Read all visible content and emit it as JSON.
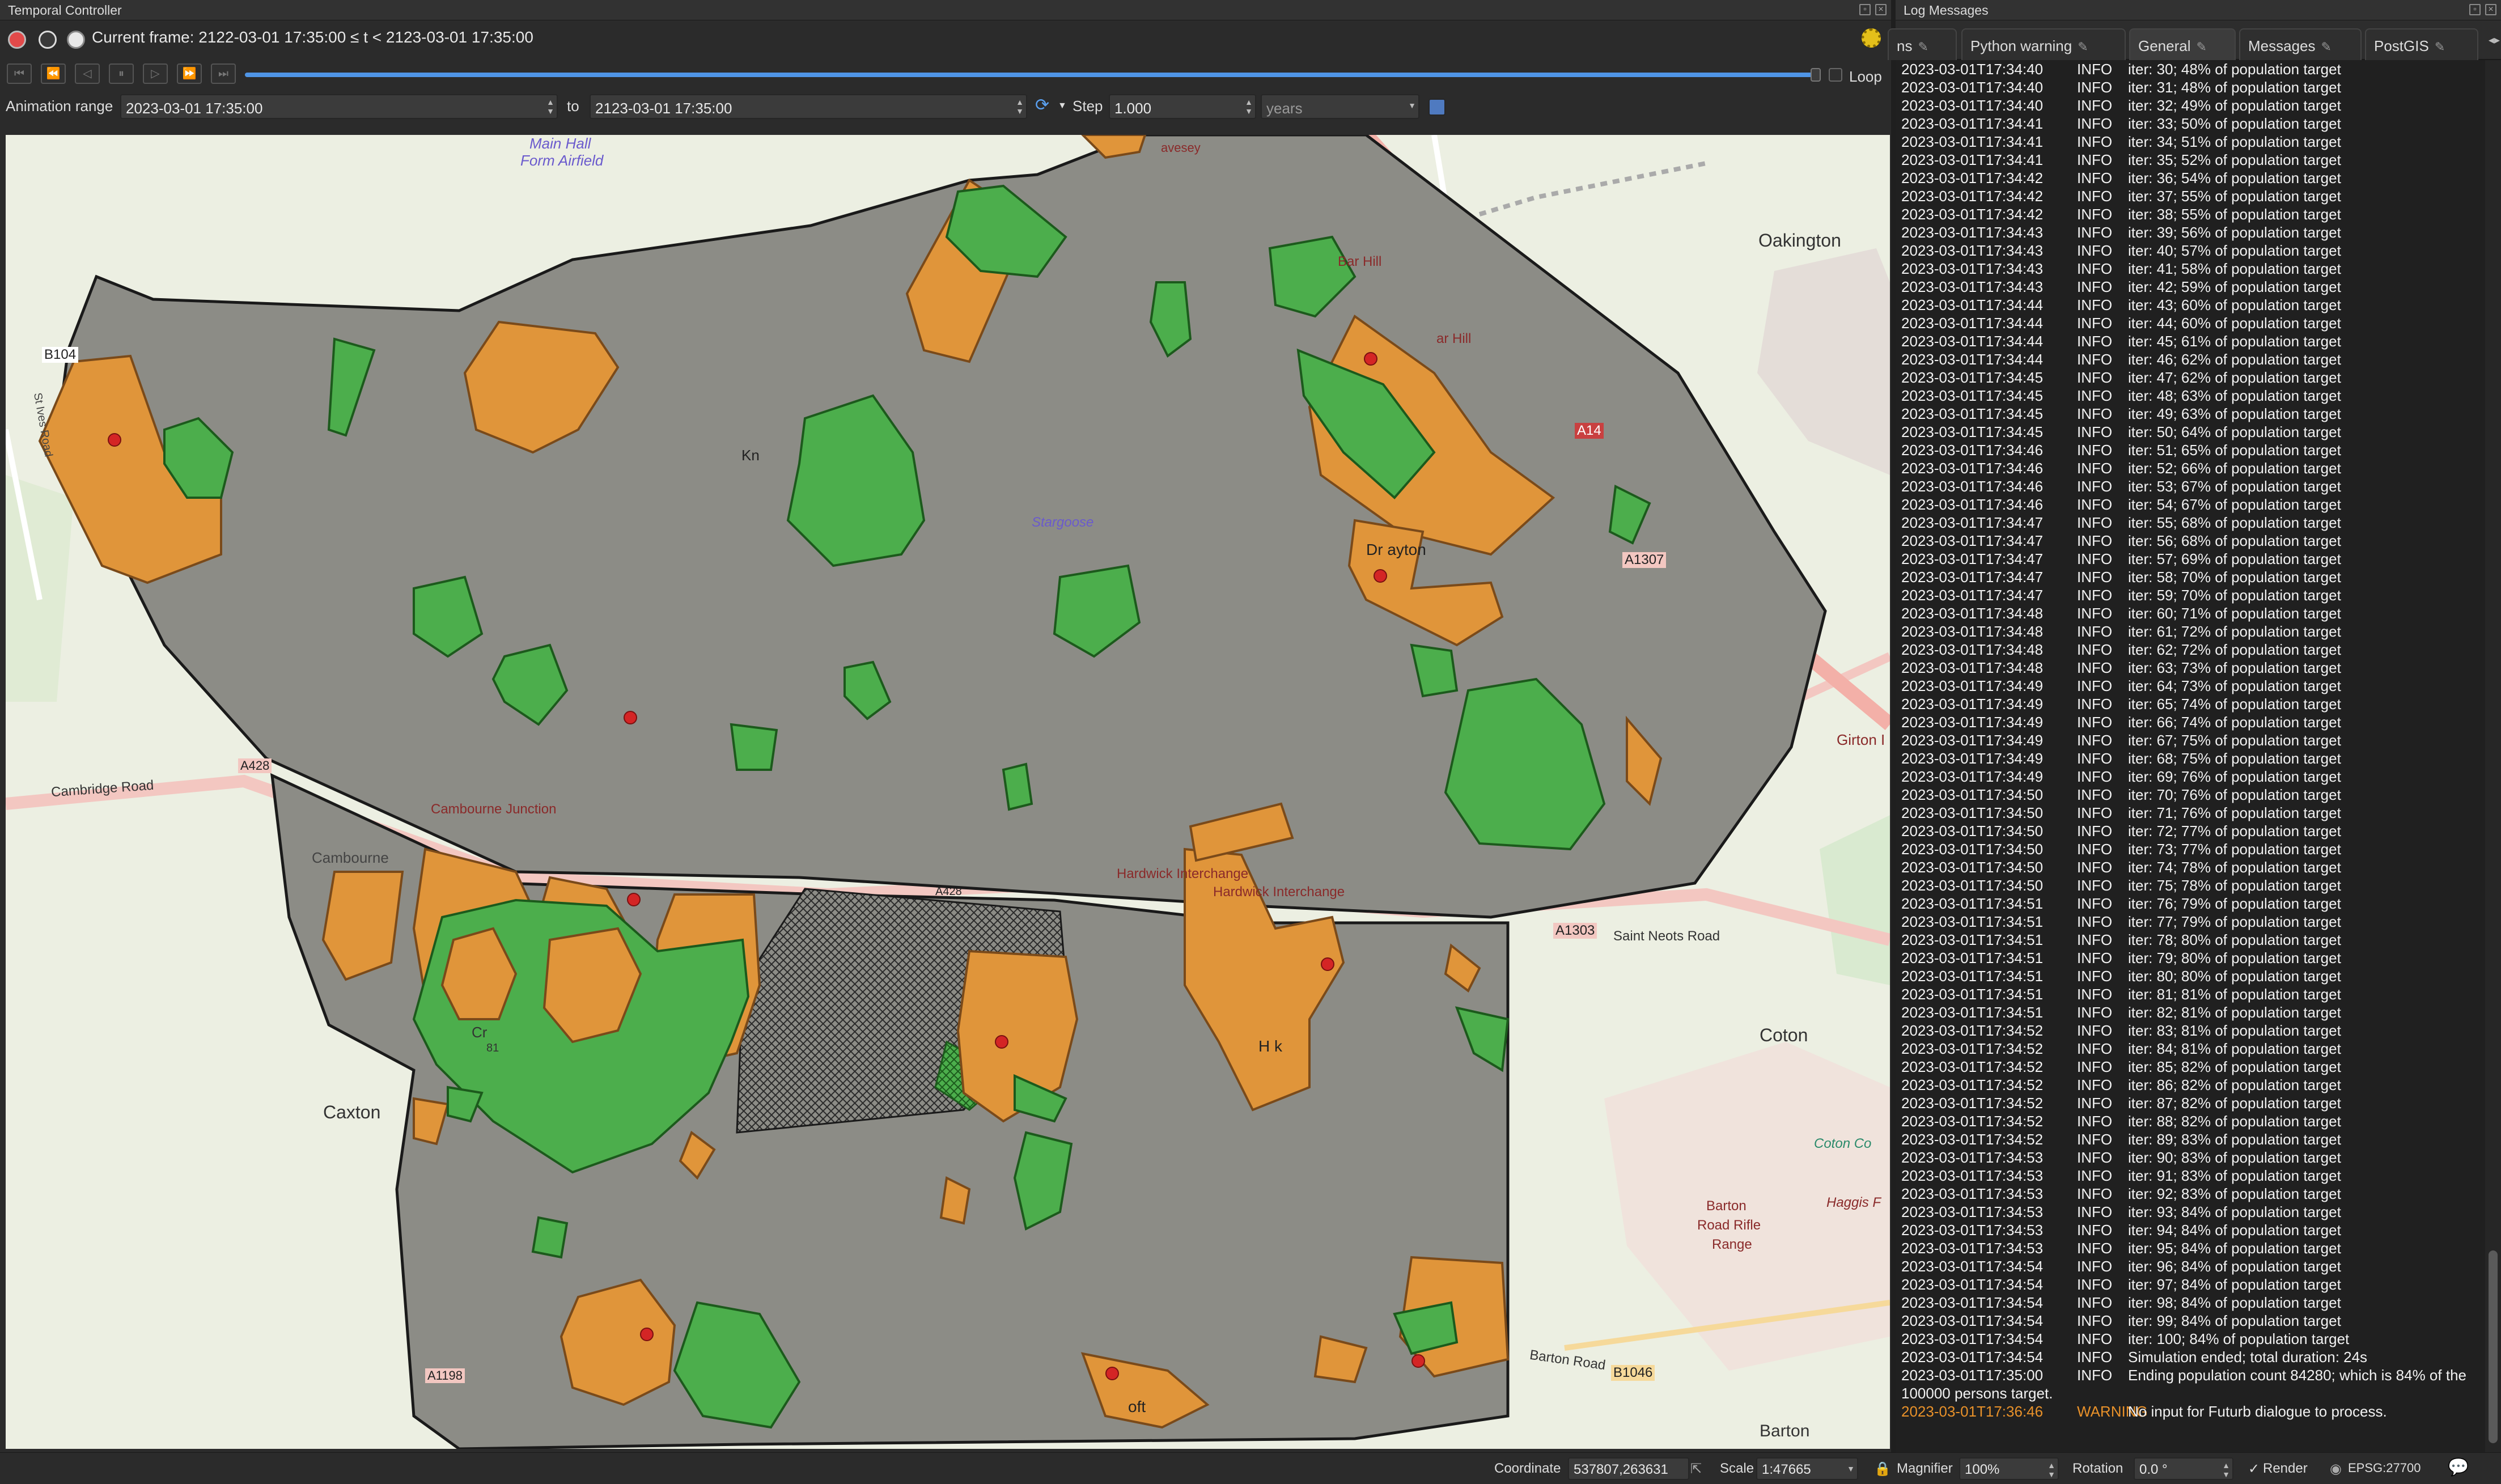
{
  "temporal_controller": {
    "title": "Temporal Controller",
    "current_frame": "Current frame: 2122-03-01 17:35:00 ≤ t < 2123-03-01 17:35:00",
    "loop_label": "Loop",
    "animation_range_label": "Animation range",
    "range_start": "2023-03-01 17:35:00",
    "to_label": "to",
    "range_end": "2123-03-01 17:35:00",
    "step_label": "Step",
    "step_value": "1.000",
    "step_unit": "years"
  },
  "map": {
    "labels": {
      "main_hall": "Main Hall",
      "form_airfield": "Form Airfield",
      "b1040": "B104",
      "st_ives_road": "St Ives Road",
      "oakington": "Oakington",
      "bar_hill_1": "Bar Hill",
      "bar_hill_2": "ar Hill",
      "a14": "A14",
      "knapwell": "Kn",
      "stargoose": "Stargoose",
      "dry_drayton": "Dr    ayton",
      "a1307": "A1307",
      "girton": "Girton I",
      "cambridge_road": "Cambridge Road",
      "a428_left": "A428",
      "cambourne_junction": "Cambourne Junction",
      "cambourne": "Cambourne",
      "hardwick_interchange_1": "Hardwick Interchange",
      "hardwick_interchange_2": "Hardwick Interchange",
      "a428_mid": "A428",
      "a1303": "A1303",
      "st_neots_road": "Saint Neots Road",
      "coton": "Coton",
      "caxton": "Caxton",
      "hardwick": "H     k",
      "coton_countryside": "Coton Co",
      "barton_rifle_1": "Barton",
      "barton_rifle_2": "Road Rifle",
      "barton_rifle_3": "Range",
      "haggis": "Haggis F",
      "barton_road": "Barton Road",
      "b1046": "B1046",
      "barton": "Barton",
      "a1198": "A1198",
      "toft": "oft",
      "eversden": "avesey",
      "cr": "Cr",
      "num81": "81"
    }
  },
  "status_bar": {
    "coordinate_label": "Coordinate",
    "coordinate_value": "537807,263631",
    "scale_label": "Scale",
    "scale_value": "1:47665",
    "magnifier_label": "Magnifier",
    "magnifier_value": "100%",
    "rotation_label": "Rotation",
    "rotation_value": "0.0 °",
    "render_label": "Render",
    "crs_label": "EPSG:27700"
  },
  "log_messages": {
    "title": "Log Messages",
    "tabs": [
      {
        "label": "ns"
      },
      {
        "label": "Python warning"
      },
      {
        "label": "General"
      },
      {
        "label": "Messages"
      },
      {
        "label": "PostGIS"
      }
    ],
    "entries": [
      {
        "ts": "2023-03-01T17:34:40",
        "level": "INFO",
        "msg": "iter: 30; 48% of population target"
      },
      {
        "ts": "2023-03-01T17:34:40",
        "level": "INFO",
        "msg": "iter: 31; 48% of population target"
      },
      {
        "ts": "2023-03-01T17:34:40",
        "level": "INFO",
        "msg": "iter: 32; 49% of population target"
      },
      {
        "ts": "2023-03-01T17:34:41",
        "level": "INFO",
        "msg": "iter: 33; 50% of population target"
      },
      {
        "ts": "2023-03-01T17:34:41",
        "level": "INFO",
        "msg": "iter: 34; 51% of population target"
      },
      {
        "ts": "2023-03-01T17:34:41",
        "level": "INFO",
        "msg": "iter: 35; 52% of population target"
      },
      {
        "ts": "2023-03-01T17:34:42",
        "level": "INFO",
        "msg": "iter: 36; 54% of population target"
      },
      {
        "ts": "2023-03-01T17:34:42",
        "level": "INFO",
        "msg": "iter: 37; 55% of population target"
      },
      {
        "ts": "2023-03-01T17:34:42",
        "level": "INFO",
        "msg": "iter: 38; 55% of population target"
      },
      {
        "ts": "2023-03-01T17:34:43",
        "level": "INFO",
        "msg": "iter: 39; 56% of population target"
      },
      {
        "ts": "2023-03-01T17:34:43",
        "level": "INFO",
        "msg": "iter: 40; 57% of population target"
      },
      {
        "ts": "2023-03-01T17:34:43",
        "level": "INFO",
        "msg": "iter: 41; 58% of population target"
      },
      {
        "ts": "2023-03-01T17:34:43",
        "level": "INFO",
        "msg": "iter: 42; 59% of population target"
      },
      {
        "ts": "2023-03-01T17:34:44",
        "level": "INFO",
        "msg": "iter: 43; 60% of population target"
      },
      {
        "ts": "2023-03-01T17:34:44",
        "level": "INFO",
        "msg": "iter: 44; 60% of population target"
      },
      {
        "ts": "2023-03-01T17:34:44",
        "level": "INFO",
        "msg": "iter: 45; 61% of population target"
      },
      {
        "ts": "2023-03-01T17:34:44",
        "level": "INFO",
        "msg": "iter: 46; 62% of population target"
      },
      {
        "ts": "2023-03-01T17:34:45",
        "level": "INFO",
        "msg": "iter: 47; 62% of population target"
      },
      {
        "ts": "2023-03-01T17:34:45",
        "level": "INFO",
        "msg": "iter: 48; 63% of population target"
      },
      {
        "ts": "2023-03-01T17:34:45",
        "level": "INFO",
        "msg": "iter: 49; 63% of population target"
      },
      {
        "ts": "2023-03-01T17:34:45",
        "level": "INFO",
        "msg": "iter: 50; 64% of population target"
      },
      {
        "ts": "2023-03-01T17:34:46",
        "level": "INFO",
        "msg": "iter: 51; 65% of population target"
      },
      {
        "ts": "2023-03-01T17:34:46",
        "level": "INFO",
        "msg": "iter: 52; 66% of population target"
      },
      {
        "ts": "2023-03-01T17:34:46",
        "level": "INFO",
        "msg": "iter: 53; 67% of population target"
      },
      {
        "ts": "2023-03-01T17:34:46",
        "level": "INFO",
        "msg": "iter: 54; 67% of population target"
      },
      {
        "ts": "2023-03-01T17:34:47",
        "level": "INFO",
        "msg": "iter: 55; 68% of population target"
      },
      {
        "ts": "2023-03-01T17:34:47",
        "level": "INFO",
        "msg": "iter: 56; 68% of population target"
      },
      {
        "ts": "2023-03-01T17:34:47",
        "level": "INFO",
        "msg": "iter: 57; 69% of population target"
      },
      {
        "ts": "2023-03-01T17:34:47",
        "level": "INFO",
        "msg": "iter: 58; 70% of population target"
      },
      {
        "ts": "2023-03-01T17:34:47",
        "level": "INFO",
        "msg": "iter: 59; 70% of population target"
      },
      {
        "ts": "2023-03-01T17:34:48",
        "level": "INFO",
        "msg": "iter: 60; 71% of population target"
      },
      {
        "ts": "2023-03-01T17:34:48",
        "level": "INFO",
        "msg": "iter: 61; 72% of population target"
      },
      {
        "ts": "2023-03-01T17:34:48",
        "level": "INFO",
        "msg": "iter: 62; 72% of population target"
      },
      {
        "ts": "2023-03-01T17:34:48",
        "level": "INFO",
        "msg": "iter: 63; 73% of population target"
      },
      {
        "ts": "2023-03-01T17:34:49",
        "level": "INFO",
        "msg": "iter: 64; 73% of population target"
      },
      {
        "ts": "2023-03-01T17:34:49",
        "level": "INFO",
        "msg": "iter: 65; 74% of population target"
      },
      {
        "ts": "2023-03-01T17:34:49",
        "level": "INFO",
        "msg": "iter: 66; 74% of population target"
      },
      {
        "ts": "2023-03-01T17:34:49",
        "level": "INFO",
        "msg": "iter: 67; 75% of population target"
      },
      {
        "ts": "2023-03-01T17:34:49",
        "level": "INFO",
        "msg": "iter: 68; 75% of population target"
      },
      {
        "ts": "2023-03-01T17:34:49",
        "level": "INFO",
        "msg": "iter: 69; 76% of population target"
      },
      {
        "ts": "2023-03-01T17:34:50",
        "level": "INFO",
        "msg": "iter: 70; 76% of population target"
      },
      {
        "ts": "2023-03-01T17:34:50",
        "level": "INFO",
        "msg": "iter: 71; 76% of population target"
      },
      {
        "ts": "2023-03-01T17:34:50",
        "level": "INFO",
        "msg": "iter: 72; 77% of population target"
      },
      {
        "ts": "2023-03-01T17:34:50",
        "level": "INFO",
        "msg": "iter: 73; 77% of population target"
      },
      {
        "ts": "2023-03-01T17:34:50",
        "level": "INFO",
        "msg": "iter: 74; 78% of population target"
      },
      {
        "ts": "2023-03-01T17:34:50",
        "level": "INFO",
        "msg": "iter: 75; 78% of population target"
      },
      {
        "ts": "2023-03-01T17:34:51",
        "level": "INFO",
        "msg": "iter: 76; 79% of population target"
      },
      {
        "ts": "2023-03-01T17:34:51",
        "level": "INFO",
        "msg": "iter: 77; 79% of population target"
      },
      {
        "ts": "2023-03-01T17:34:51",
        "level": "INFO",
        "msg": "iter: 78; 80% of population target"
      },
      {
        "ts": "2023-03-01T17:34:51",
        "level": "INFO",
        "msg": "iter: 79; 80% of population target"
      },
      {
        "ts": "2023-03-01T17:34:51",
        "level": "INFO",
        "msg": "iter: 80; 80% of population target"
      },
      {
        "ts": "2023-03-01T17:34:51",
        "level": "INFO",
        "msg": "iter: 81; 81% of population target"
      },
      {
        "ts": "2023-03-01T17:34:51",
        "level": "INFO",
        "msg": "iter: 82; 81% of population target"
      },
      {
        "ts": "2023-03-01T17:34:52",
        "level": "INFO",
        "msg": "iter: 83; 81% of population target"
      },
      {
        "ts": "2023-03-01T17:34:52",
        "level": "INFO",
        "msg": "iter: 84; 81% of population target"
      },
      {
        "ts": "2023-03-01T17:34:52",
        "level": "INFO",
        "msg": "iter: 85; 82% of population target"
      },
      {
        "ts": "2023-03-01T17:34:52",
        "level": "INFO",
        "msg": "iter: 86; 82% of population target"
      },
      {
        "ts": "2023-03-01T17:34:52",
        "level": "INFO",
        "msg": "iter: 87; 82% of population target"
      },
      {
        "ts": "2023-03-01T17:34:52",
        "level": "INFO",
        "msg": "iter: 88; 82% of population target"
      },
      {
        "ts": "2023-03-01T17:34:52",
        "level": "INFO",
        "msg": "iter: 89; 83% of population target"
      },
      {
        "ts": "2023-03-01T17:34:53",
        "level": "INFO",
        "msg": "iter: 90; 83% of population target"
      },
      {
        "ts": "2023-03-01T17:34:53",
        "level": "INFO",
        "msg": "iter: 91; 83% of population target"
      },
      {
        "ts": "2023-03-01T17:34:53",
        "level": "INFO",
        "msg": "iter: 92; 83% of population target"
      },
      {
        "ts": "2023-03-01T17:34:53",
        "level": "INFO",
        "msg": "iter: 93; 84% of population target"
      },
      {
        "ts": "2023-03-01T17:34:53",
        "level": "INFO",
        "msg": "iter: 94; 84% of population target"
      },
      {
        "ts": "2023-03-01T17:34:53",
        "level": "INFO",
        "msg": "iter: 95; 84% of population target"
      },
      {
        "ts": "2023-03-01T17:34:54",
        "level": "INFO",
        "msg": "iter: 96; 84% of population target"
      },
      {
        "ts": "2023-03-01T17:34:54",
        "level": "INFO",
        "msg": "iter: 97; 84% of population target"
      },
      {
        "ts": "2023-03-01T17:34:54",
        "level": "INFO",
        "msg": "iter: 98; 84% of population target"
      },
      {
        "ts": "2023-03-01T17:34:54",
        "level": "INFO",
        "msg": "iter: 99; 84% of population target"
      },
      {
        "ts": "2023-03-01T17:34:54",
        "level": "INFO",
        "msg": "iter: 100; 84% of population target"
      },
      {
        "ts": "2023-03-01T17:34:54",
        "level": "INFO",
        "msg": "Simulation ended; total duration: 24s"
      },
      {
        "ts": "2023-03-01T17:35:00",
        "level": "INFO",
        "msg": "Ending population count 84280; which is 84% of the 100000 persons target."
      },
      {
        "ts": "2023-03-01T17:36:46",
        "level": "WARNING",
        "msg": "No input for Futurb dialogue to process."
      }
    ]
  },
  "colors": {
    "zone_grey": "#8c8c86",
    "urban_orange": "#e0953a",
    "green_space": "#4cae4c",
    "boundary": "#1a1a1a",
    "point_red": "#d42525",
    "road_pink": "#f6c9c5",
    "slider_blue": "#4f95e6"
  }
}
